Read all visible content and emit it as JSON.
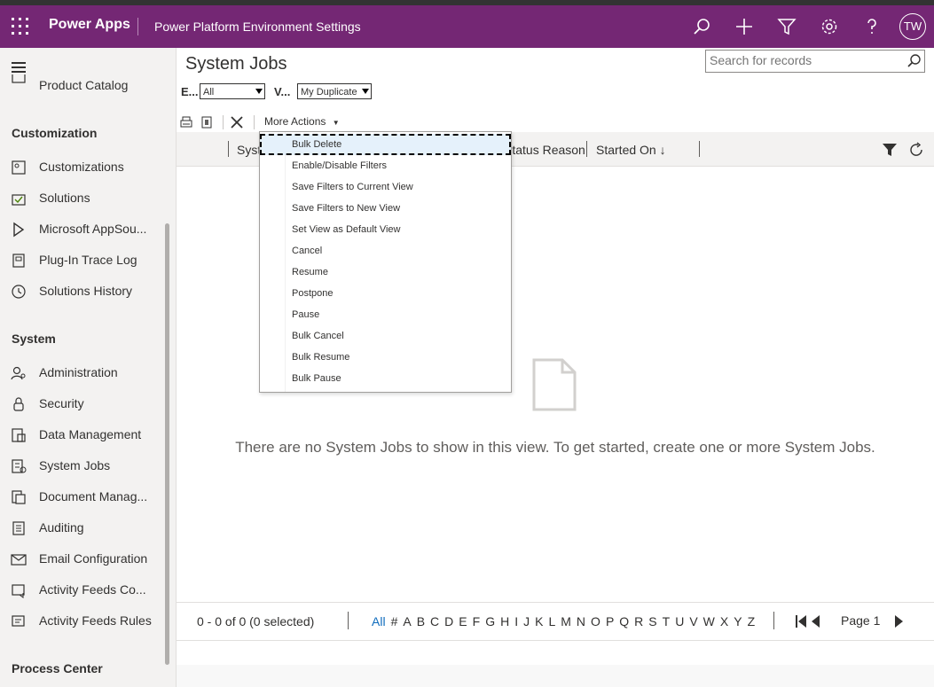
{
  "topbar": {
    "app_name": "Power Apps",
    "environment": "Power Platform Environment Settings",
    "avatar_initials": "TW",
    "brand_color": "#742774"
  },
  "sidebar": {
    "partial_item": "Product Catalog",
    "sections": [
      {
        "heading": "Customization"
      },
      {
        "heading": "System"
      },
      {
        "heading": "Process Center"
      }
    ],
    "items": [
      {
        "label": "Customizations",
        "icon": "customizations-icon"
      },
      {
        "label": "Solutions",
        "icon": "solutions-icon"
      },
      {
        "label": "Microsoft AppSou...",
        "icon": "appsource-icon"
      },
      {
        "label": "Plug-In Trace Log",
        "icon": "trace-log-icon"
      },
      {
        "label": "Solutions History",
        "icon": "history-icon"
      },
      {
        "label": "Administration",
        "icon": "administration-icon"
      },
      {
        "label": "Security",
        "icon": "lock-icon"
      },
      {
        "label": "Data Management",
        "icon": "data-management-icon"
      },
      {
        "label": "System Jobs",
        "icon": "system-jobs-icon"
      },
      {
        "label": "Document Manag...",
        "icon": "document-icon"
      },
      {
        "label": "Auditing",
        "icon": "auditing-icon"
      },
      {
        "label": "Email Configuration",
        "icon": "email-icon"
      },
      {
        "label": "Activity Feeds Co...",
        "icon": "activity-feeds-icon"
      },
      {
        "label": "Activity Feeds Rules",
        "icon": "activity-rules-icon"
      }
    ]
  },
  "main": {
    "title": "System Jobs",
    "search_placeholder": "Search for records",
    "filter_entity_label": "E...",
    "filter_entity_value": "All",
    "filter_view_label": "V...",
    "filter_view_value": "My Duplicate",
    "more_actions": "More Actions",
    "columns": [
      "Syst",
      "Status Reason",
      "Started On"
    ],
    "empty_message": "There are no System Jobs to show in this view. To get started, create one or more System Jobs.",
    "record_count": "0 - 0 of 0 (0 selected)",
    "alphabet": [
      "All",
      "#",
      "A",
      "B",
      "C",
      "D",
      "E",
      "F",
      "G",
      "H",
      "I",
      "J",
      "K",
      "L",
      "M",
      "N",
      "O",
      "P",
      "Q",
      "R",
      "S",
      "T",
      "U",
      "V",
      "W",
      "X",
      "Y",
      "Z"
    ],
    "page_label": "Page 1"
  },
  "menu": {
    "items": [
      "Bulk Delete",
      "Enable/Disable Filters",
      "Save Filters to Current View",
      "Save Filters to New View",
      "Set View as Default View",
      "Cancel",
      "Resume",
      "Postpone",
      "Pause",
      "Bulk Cancel",
      "Bulk Resume",
      "Bulk Pause"
    ],
    "focused_index": 0
  }
}
